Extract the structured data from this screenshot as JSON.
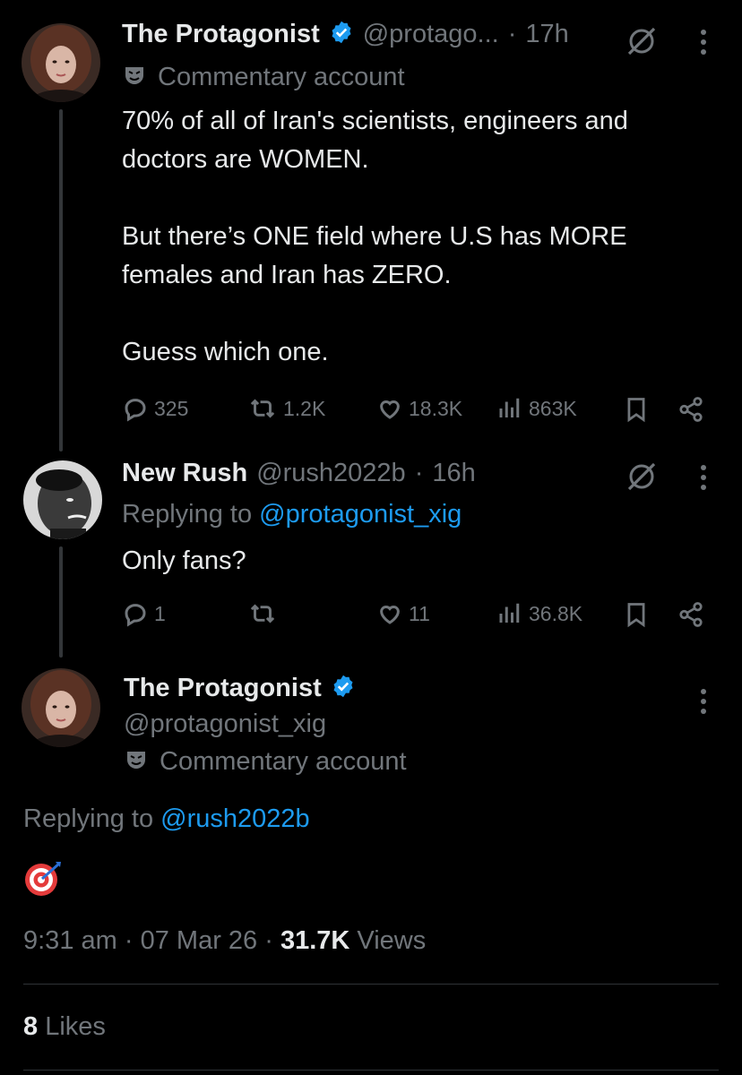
{
  "tweet1": {
    "name": "The Protagonist",
    "handle": "@protago...",
    "sep": "·",
    "time": "17h",
    "commentary": "Commentary account",
    "lines": [
      "70% of all of Iran's scientists, engineers and",
      "doctors are WOMEN.",
      "But there’s ONE field where U.S has MORE",
      "females and Iran has ZERO.",
      "Guess which one."
    ],
    "replies": "325",
    "reposts": "1.2K",
    "likes": "18.3K",
    "views": "863K"
  },
  "tweet2": {
    "name": "New Rush",
    "handle": "@rush2022b",
    "sep": "·",
    "time": "16h",
    "replying_prefix": "Replying to",
    "replying_handle": "@protagonist_xig",
    "text": "Only fans?",
    "replies": "1",
    "likes": "11",
    "views": "36.8K"
  },
  "tweet3": {
    "name": "The Protagonist",
    "handle": "@protagonist_xig",
    "commentary": "Commentary account",
    "replying_prefix": "Replying to",
    "replying_handle": "@rush2022b",
    "time": "9:31 am",
    "date": "07 Mar 26",
    "sep": "·",
    "views_count": "31.7K",
    "views_label": "Views",
    "likes_count": "8",
    "likes_label": "Likes"
  },
  "colors": {
    "accent": "#1d9bf0",
    "muted": "#71767b",
    "background": "#000000",
    "text": "#e7e9ea"
  },
  "icons": [
    "verified-badge-icon",
    "grok-slash-icon",
    "more-icon",
    "mask-icon",
    "reply-icon",
    "repost-icon",
    "like-icon",
    "views-icon",
    "bookmark-icon",
    "share-icon",
    "target-emoji-icon"
  ]
}
